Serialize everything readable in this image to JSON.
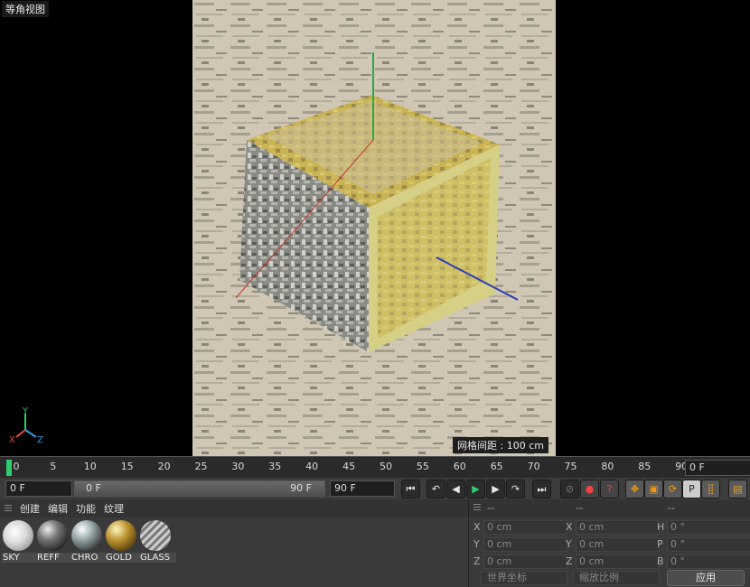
{
  "viewport": {
    "title": "等角视图",
    "grid_label": "网格间距 : 100 cm",
    "axis": {
      "x": "X",
      "y": "Y",
      "z": "Z"
    }
  },
  "timeline": {
    "ticks": [
      "0",
      "5",
      "10",
      "15",
      "20",
      "25",
      "30",
      "35",
      "40",
      "45",
      "50",
      "55",
      "60",
      "65",
      "70",
      "75",
      "80",
      "85",
      "90"
    ],
    "current_frame": "0 F"
  },
  "controls": {
    "start_frame": "0 F",
    "range_start": "0 F",
    "range_end": "90 F",
    "end_frame": "90 F"
  },
  "material_panel": {
    "menu": [
      "创建",
      "编辑",
      "功能",
      "纹理"
    ],
    "materials": [
      "SKY",
      "REFF",
      "CHRO",
      "GOLD",
      "GLASS"
    ]
  },
  "coord_panel": {
    "header_left": "--",
    "header_mid": "--",
    "header_right": "--",
    "rows": [
      {
        "l1": "X",
        "v1": "0 cm",
        "l2": "X",
        "v2": "0 cm",
        "l3": "H",
        "v3": "0 °"
      },
      {
        "l1": "Y",
        "v1": "0 cm",
        "l2": "Y",
        "v2": "0 cm",
        "l3": "P",
        "v3": "0 °"
      },
      {
        "l1": "Z",
        "v1": "0 cm",
        "l2": "Z",
        "v2": "0 cm",
        "l3": "B",
        "v3": "0 °"
      }
    ],
    "world_coords": "世界坐标",
    "scale": "缩放比例",
    "apply": "应用"
  }
}
